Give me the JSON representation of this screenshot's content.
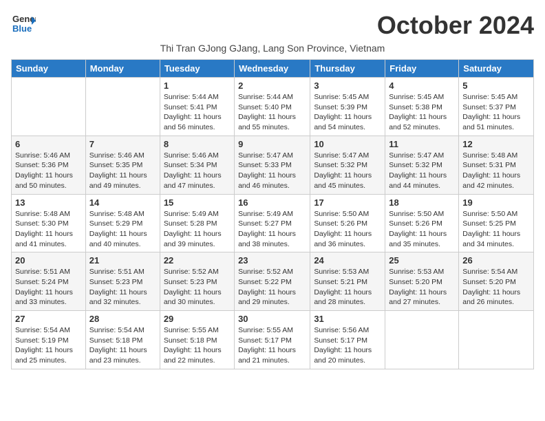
{
  "header": {
    "logo_general": "General",
    "logo_blue": "Blue",
    "month_title": "October 2024",
    "subtitle": "Thi Tran GJong GJang, Lang Son Province, Vietnam"
  },
  "weekdays": [
    "Sunday",
    "Monday",
    "Tuesday",
    "Wednesday",
    "Thursday",
    "Friday",
    "Saturday"
  ],
  "weeks": [
    [
      {
        "day": "",
        "sunrise": "",
        "sunset": "",
        "daylight": ""
      },
      {
        "day": "",
        "sunrise": "",
        "sunset": "",
        "daylight": ""
      },
      {
        "day": "1",
        "sunrise": "Sunrise: 5:44 AM",
        "sunset": "Sunset: 5:41 PM",
        "daylight": "Daylight: 11 hours and 56 minutes."
      },
      {
        "day": "2",
        "sunrise": "Sunrise: 5:44 AM",
        "sunset": "Sunset: 5:40 PM",
        "daylight": "Daylight: 11 hours and 55 minutes."
      },
      {
        "day": "3",
        "sunrise": "Sunrise: 5:45 AM",
        "sunset": "Sunset: 5:39 PM",
        "daylight": "Daylight: 11 hours and 54 minutes."
      },
      {
        "day": "4",
        "sunrise": "Sunrise: 5:45 AM",
        "sunset": "Sunset: 5:38 PM",
        "daylight": "Daylight: 11 hours and 52 minutes."
      },
      {
        "day": "5",
        "sunrise": "Sunrise: 5:45 AM",
        "sunset": "Sunset: 5:37 PM",
        "daylight": "Daylight: 11 hours and 51 minutes."
      }
    ],
    [
      {
        "day": "6",
        "sunrise": "Sunrise: 5:46 AM",
        "sunset": "Sunset: 5:36 PM",
        "daylight": "Daylight: 11 hours and 50 minutes."
      },
      {
        "day": "7",
        "sunrise": "Sunrise: 5:46 AM",
        "sunset": "Sunset: 5:35 PM",
        "daylight": "Daylight: 11 hours and 49 minutes."
      },
      {
        "day": "8",
        "sunrise": "Sunrise: 5:46 AM",
        "sunset": "Sunset: 5:34 PM",
        "daylight": "Daylight: 11 hours and 47 minutes."
      },
      {
        "day": "9",
        "sunrise": "Sunrise: 5:47 AM",
        "sunset": "Sunset: 5:33 PM",
        "daylight": "Daylight: 11 hours and 46 minutes."
      },
      {
        "day": "10",
        "sunrise": "Sunrise: 5:47 AM",
        "sunset": "Sunset: 5:32 PM",
        "daylight": "Daylight: 11 hours and 45 minutes."
      },
      {
        "day": "11",
        "sunrise": "Sunrise: 5:47 AM",
        "sunset": "Sunset: 5:32 PM",
        "daylight": "Daylight: 11 hours and 44 minutes."
      },
      {
        "day": "12",
        "sunrise": "Sunrise: 5:48 AM",
        "sunset": "Sunset: 5:31 PM",
        "daylight": "Daylight: 11 hours and 42 minutes."
      }
    ],
    [
      {
        "day": "13",
        "sunrise": "Sunrise: 5:48 AM",
        "sunset": "Sunset: 5:30 PM",
        "daylight": "Daylight: 11 hours and 41 minutes."
      },
      {
        "day": "14",
        "sunrise": "Sunrise: 5:48 AM",
        "sunset": "Sunset: 5:29 PM",
        "daylight": "Daylight: 11 hours and 40 minutes."
      },
      {
        "day": "15",
        "sunrise": "Sunrise: 5:49 AM",
        "sunset": "Sunset: 5:28 PM",
        "daylight": "Daylight: 11 hours and 39 minutes."
      },
      {
        "day": "16",
        "sunrise": "Sunrise: 5:49 AM",
        "sunset": "Sunset: 5:27 PM",
        "daylight": "Daylight: 11 hours and 38 minutes."
      },
      {
        "day": "17",
        "sunrise": "Sunrise: 5:50 AM",
        "sunset": "Sunset: 5:26 PM",
        "daylight": "Daylight: 11 hours and 36 minutes."
      },
      {
        "day": "18",
        "sunrise": "Sunrise: 5:50 AM",
        "sunset": "Sunset: 5:26 PM",
        "daylight": "Daylight: 11 hours and 35 minutes."
      },
      {
        "day": "19",
        "sunrise": "Sunrise: 5:50 AM",
        "sunset": "Sunset: 5:25 PM",
        "daylight": "Daylight: 11 hours and 34 minutes."
      }
    ],
    [
      {
        "day": "20",
        "sunrise": "Sunrise: 5:51 AM",
        "sunset": "Sunset: 5:24 PM",
        "daylight": "Daylight: 11 hours and 33 minutes."
      },
      {
        "day": "21",
        "sunrise": "Sunrise: 5:51 AM",
        "sunset": "Sunset: 5:23 PM",
        "daylight": "Daylight: 11 hours and 32 minutes."
      },
      {
        "day": "22",
        "sunrise": "Sunrise: 5:52 AM",
        "sunset": "Sunset: 5:23 PM",
        "daylight": "Daylight: 11 hours and 30 minutes."
      },
      {
        "day": "23",
        "sunrise": "Sunrise: 5:52 AM",
        "sunset": "Sunset: 5:22 PM",
        "daylight": "Daylight: 11 hours and 29 minutes."
      },
      {
        "day": "24",
        "sunrise": "Sunrise: 5:53 AM",
        "sunset": "Sunset: 5:21 PM",
        "daylight": "Daylight: 11 hours and 28 minutes."
      },
      {
        "day": "25",
        "sunrise": "Sunrise: 5:53 AM",
        "sunset": "Sunset: 5:20 PM",
        "daylight": "Daylight: 11 hours and 27 minutes."
      },
      {
        "day": "26",
        "sunrise": "Sunrise: 5:54 AM",
        "sunset": "Sunset: 5:20 PM",
        "daylight": "Daylight: 11 hours and 26 minutes."
      }
    ],
    [
      {
        "day": "27",
        "sunrise": "Sunrise: 5:54 AM",
        "sunset": "Sunset: 5:19 PM",
        "daylight": "Daylight: 11 hours and 25 minutes."
      },
      {
        "day": "28",
        "sunrise": "Sunrise: 5:54 AM",
        "sunset": "Sunset: 5:18 PM",
        "daylight": "Daylight: 11 hours and 23 minutes."
      },
      {
        "day": "29",
        "sunrise": "Sunrise: 5:55 AM",
        "sunset": "Sunset: 5:18 PM",
        "daylight": "Daylight: 11 hours and 22 minutes."
      },
      {
        "day": "30",
        "sunrise": "Sunrise: 5:55 AM",
        "sunset": "Sunset: 5:17 PM",
        "daylight": "Daylight: 11 hours and 21 minutes."
      },
      {
        "day": "31",
        "sunrise": "Sunrise: 5:56 AM",
        "sunset": "Sunset: 5:17 PM",
        "daylight": "Daylight: 11 hours and 20 minutes."
      },
      {
        "day": "",
        "sunrise": "",
        "sunset": "",
        "daylight": ""
      },
      {
        "day": "",
        "sunrise": "",
        "sunset": "",
        "daylight": ""
      }
    ]
  ]
}
